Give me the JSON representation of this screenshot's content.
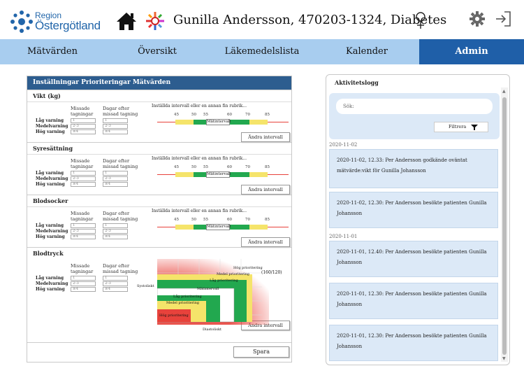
{
  "header": {
    "logo_line1": "Region",
    "logo_line2": "Östergötland",
    "patient_title": "Gunilla Andersson, 470203-1324, Diabetes",
    "icons": [
      "home-icon",
      "medicine-wheel-icon",
      "female-icon",
      "gear-icon",
      "logout-icon"
    ]
  },
  "nav": {
    "tabs": [
      {
        "label": "Mätvärden",
        "active": false
      },
      {
        "label": "Översikt",
        "active": false
      },
      {
        "label": "Läkemedelslista",
        "active": false
      },
      {
        "label": "Kalender",
        "active": false
      },
      {
        "label": "Admin",
        "active": true
      }
    ]
  },
  "settings": {
    "title": "Inställningar Prioriteringar Mätvärden",
    "col_missed": "Missade tagningar",
    "col_days": "Dagar efter missad tagning",
    "row_labels": [
      "Låg varning",
      "Medelvarning",
      "Hög varning"
    ],
    "interval_hint": "Inställda intervall eller en annan fin rubrik...",
    "interval_ticks": [
      "45",
      "50",
      "55",
      "60",
      "70",
      "85"
    ],
    "interval_mid": "Mätintervall",
    "change_button": "Ändra intervall",
    "sections": [
      {
        "name": "Vikt (kg)",
        "missed": [
          "1",
          "2-3",
          "≥4"
        ],
        "days": [
          "1",
          "2-3",
          "≥4"
        ]
      },
      {
        "name": "Syresättning",
        "missed": [
          "1",
          "2-3",
          "≥4"
        ],
        "days": [
          "1",
          "2-3",
          "≥4"
        ]
      },
      {
        "name": "Blodsocker",
        "missed": [
          "1",
          "2-3",
          "≥4"
        ],
        "days": [
          "1",
          "2-3",
          "≥4"
        ]
      },
      {
        "name": "Blodtryck",
        "missed": [
          "1",
          "2-3",
          "≥4"
        ],
        "days": [
          "1",
          "2-3",
          "≥4"
        ]
      }
    ],
    "bp_chart": {
      "labels": [
        "Hög prioritering",
        "Medel prioritering",
        "Låg prioritering",
        "Mätintervall",
        "Låg prioritering",
        "Medel prioritering",
        "Hög prioritering"
      ],
      "y_label": "Systoliskt",
      "x_label": "Diastoliskt",
      "corner_value": "(160/120)"
    },
    "save_button": "Spara"
  },
  "activity": {
    "title": "Aktivitetslogg",
    "search_placeholder": "Sök:",
    "filter_button": "Filtrera",
    "groups": [
      {
        "date": "2020-11-02",
        "entries": [
          "2020-11-02, 12.33: Per Andersson godkände oväntat mätvärde:vikt för Gunilla Johansson",
          "2020-11-02, 12.30: Per Andersson besökte patienten Gunilla Johansson"
        ]
      },
      {
        "date": "2020-11-01",
        "entries": [
          "2020-11-01, 12.40: Per Andersson besökte patienten Gunilla Johansson",
          "2020-11-01, 12.30: Per Andersson besökte patienten Gunilla Johansson",
          "2020-11-01, 12.30: Per Andersson besökte patienten Gunilla Johansson"
        ]
      }
    ]
  },
  "colors": {
    "nav_bg": "#a8cdef",
    "nav_active": "#1f5fa8",
    "panel_header": "#2d5d8f",
    "log_card": "#dce9f7",
    "green": "#22a84f",
    "yellow": "#f5e46a",
    "red": "#e8423b"
  }
}
